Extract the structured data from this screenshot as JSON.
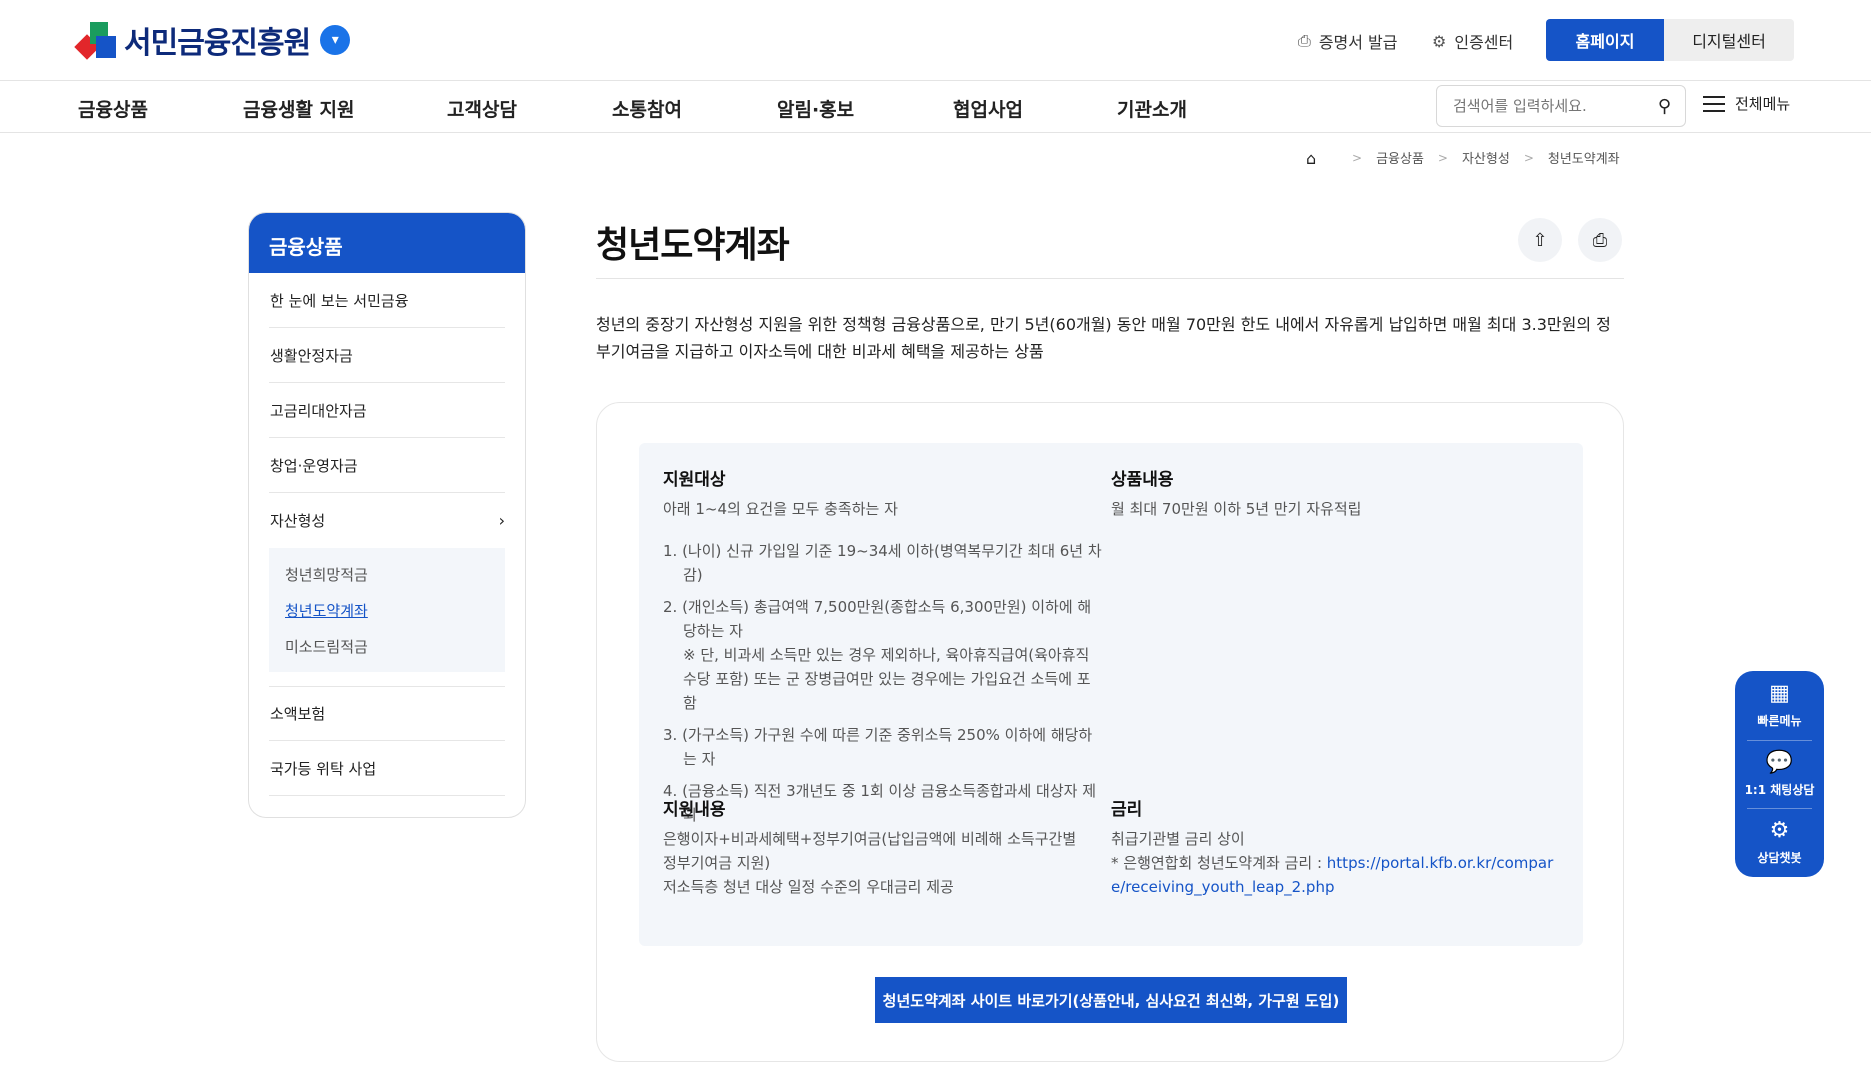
{
  "header": {
    "logo_text": "서민금융진흥원",
    "cert_issue": "증명서 발급",
    "auth_center": "인증센터",
    "home_button": "홈페이지",
    "digital_button": "디지털센터"
  },
  "gnb": {
    "items": [
      "금융상품",
      "금융생활 지원",
      "고객상담",
      "소통참여",
      "알림·홍보",
      "협업사업",
      "기관소개"
    ],
    "search_placeholder": "검색어를 입력하세요.",
    "all_menu": "전체메뉴"
  },
  "breadcrumb": [
    "금융상품",
    "자산형성",
    "청년도약계좌"
  ],
  "side": {
    "title": "금융상품",
    "items": [
      "한 눈에 보는 서민금융",
      "생활안정자금",
      "고금리대안자금",
      "창업·운영자금",
      "자산형성"
    ],
    "sub_items": [
      "청년희망적금",
      "청년도약계좌",
      "미소드림적금"
    ],
    "after_items": [
      "소액보험",
      "국가등 위탁 사업"
    ]
  },
  "main": {
    "title": "청년도약계좌",
    "description": "청년의 중장기 자산형성 지원을 위한 정책형 금융상품으로, 만기 5년(60개월) 동안 매월 70만원 한도 내에서 자유롭게 납입하면 매월 최대 3.3만원의 정부기여금을 지급하고 이자소득에 대한 비과세 혜택을 제공하는 상품",
    "target": {
      "heading": "지원대상",
      "intro": "아래 1~4의 요건을 모두 충족하는 자",
      "conditions": [
        "1. (나이) 신규 가입일 기준 19~34세 이하(병역복무기간 최대 6년 차감)",
        "2. (개인소득) 총급여액 7,500만원(종합소득 6,300만원) 이하에 해당하는 자",
        "3. (가구소득) 가구원 수에 따른 기준 중위소득 250% 이하에 해당하는 자",
        "4. (금융소득) 직전 3개년도 중 1회 이상 금융소득종합과세 대상자 제외"
      ],
      "note": "※ 단, 비과세 소득만 있는 경우 제외하나, 육아휴직급여(육아휴직수당 포함) 또는 군 장병급여만 있는 경우에는 가입요건 소득에 포함"
    },
    "product": {
      "heading": "상품내용",
      "text": "월 최대 70만원 이하 5년 만기 자유적립"
    },
    "support": {
      "heading": "지원내용",
      "line1": "은행이자+비과세혜택+정부기여금(납입금액에 비례해 소득구간별 정부기여금 지원)",
      "line2": "저소득층 청년 대상 일정 수준의 우대금리 제공"
    },
    "rate": {
      "heading": "금리",
      "line1": "취급기관별 금리 상이",
      "line2_prefix": "* 은행연합회 청년도약계좌 금리 : ",
      "link": "https://portal.kfb.or.kr/compare/receiving_youth_leap_2.php"
    },
    "cta": "청년도약계좌 사이트 바로가기(상품안내, 심사요건 최신화, 가구원 도입)"
  },
  "quick_menu": {
    "fast": "빠른메뉴",
    "chat": "1:1 채팅상담",
    "bot": "상담챗봇"
  },
  "colors": {
    "primary": "#1554c7",
    "panel": "#f3f6fa"
  }
}
